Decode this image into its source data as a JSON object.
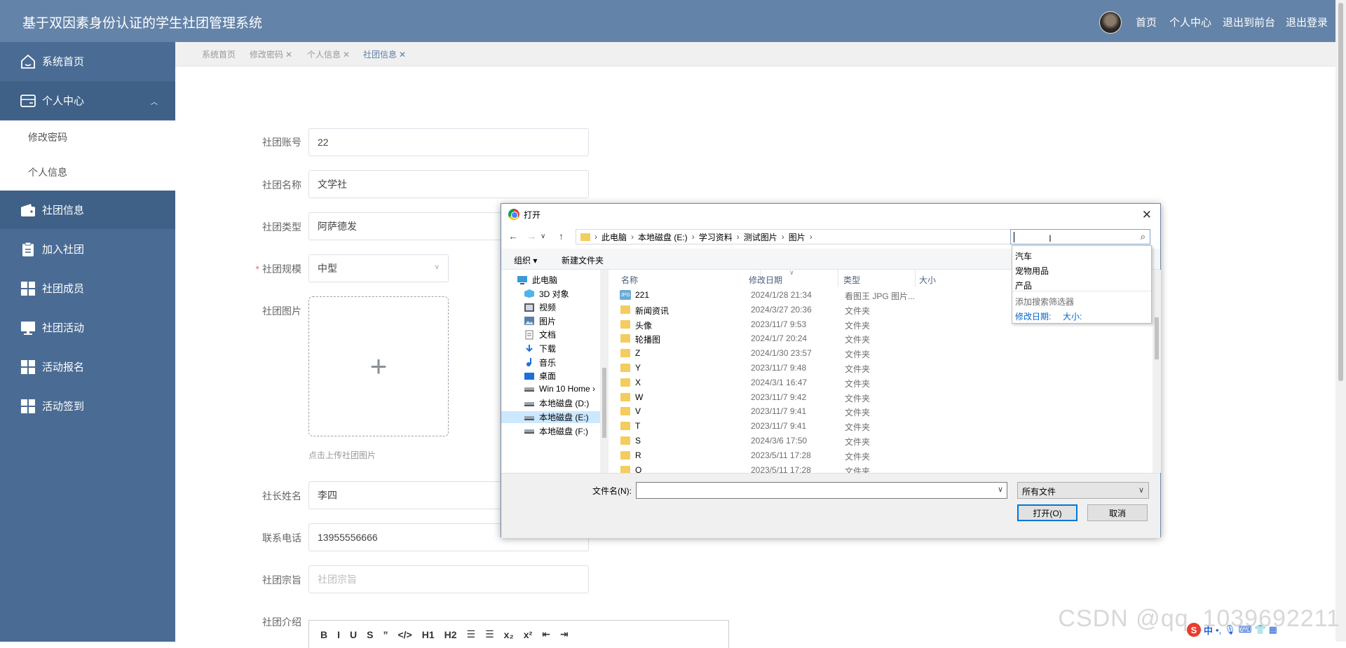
{
  "header": {
    "title": "基于双因素身份认证的学生社团管理系统",
    "links": [
      "首页",
      "个人中心",
      "退出到前台",
      "退出登录"
    ]
  },
  "sidebar": {
    "items": [
      {
        "label": "系统首页",
        "icon": "home-icon"
      },
      {
        "label": "个人中心",
        "icon": "wallet-icon"
      },
      {
        "label": "社团信息",
        "icon": "purse-icon"
      },
      {
        "label": "加入社团",
        "icon": "clipboard-icon"
      },
      {
        "label": "社团成员",
        "icon": "grid-icon"
      },
      {
        "label": "社团活动",
        "icon": "monitor-icon"
      },
      {
        "label": "活动报名",
        "icon": "grid-icon"
      },
      {
        "label": "活动签到",
        "icon": "grid-icon"
      }
    ],
    "sub_items": [
      "修改密码",
      "个人信息"
    ]
  },
  "tabs": [
    "系统首页",
    "修改密码",
    "个人信息",
    "社团信息"
  ],
  "form": {
    "account_label": "社团账号",
    "account_value": "22",
    "name_label": "社团名称",
    "name_value": "文学社",
    "type_label": "社团类型",
    "type_value": "阿萨德发",
    "scale_label": "社团规模",
    "scale_value": "中型",
    "image_label": "社团图片",
    "upload_hint": "点击上传社团图片",
    "leader_label": "社长姓名",
    "leader_value": "李四",
    "phone_label": "联系电话",
    "phone_value": "13955556666",
    "purpose_label": "社团宗旨",
    "purpose_placeholder": "社团宗旨",
    "intro_label": "社团介绍",
    "editor_tools": [
      "B",
      "I",
      "U",
      "S",
      "”",
      "</>",
      "H1",
      "H2",
      "☰",
      "☰",
      "x₂",
      "x²",
      "⇤",
      "⇥"
    ]
  },
  "dialog": {
    "title": "打开",
    "path": [
      "此电脑",
      "本地磁盘 (E:)",
      "学习资料",
      "测试图片",
      "图片"
    ],
    "toolbar": {
      "organize": "组织 ▾",
      "new_folder": "新建文件夹"
    },
    "tree": [
      {
        "label": "此电脑",
        "icon": "computer-icon"
      },
      {
        "label": "3D 对象",
        "icon": "cube-icon"
      },
      {
        "label": "视频",
        "icon": "video-icon"
      },
      {
        "label": "图片",
        "icon": "picture-icon"
      },
      {
        "label": "文档",
        "icon": "document-icon"
      },
      {
        "label": "下载",
        "icon": "download-icon"
      },
      {
        "label": "音乐",
        "icon": "music-icon"
      },
      {
        "label": "桌面",
        "icon": "desktop-icon"
      },
      {
        "label": "Win 10 Home ›",
        "icon": "drive-icon"
      },
      {
        "label": "本地磁盘 (D:)",
        "icon": "drive-icon"
      },
      {
        "label": "本地磁盘 (E:)",
        "icon": "drive-icon"
      },
      {
        "label": "本地磁盘 (F:)",
        "icon": "drive-icon"
      }
    ],
    "columns": [
      "名称",
      "修改日期",
      "类型",
      "大小"
    ],
    "files": [
      {
        "name": "221",
        "date": "2024/1/28 21:34",
        "type": "看图王 JPG 图片...",
        "kind": "jpg",
        "badge": "JPG"
      },
      {
        "name": "新闻资讯",
        "date": "2024/3/27 20:36",
        "type": "文件夹",
        "kind": "folder"
      },
      {
        "name": "头像",
        "date": "2023/11/7 9:53",
        "type": "文件夹",
        "kind": "folder"
      },
      {
        "name": "轮播图",
        "date": "2024/1/7 20:24",
        "type": "文件夹",
        "kind": "folder"
      },
      {
        "name": "Z",
        "date": "2024/1/30 23:57",
        "type": "文件夹",
        "kind": "folder"
      },
      {
        "name": "Y",
        "date": "2023/11/7 9:48",
        "type": "文件夹",
        "kind": "folder"
      },
      {
        "name": "X",
        "date": "2024/3/1 16:47",
        "type": "文件夹",
        "kind": "folder"
      },
      {
        "name": "W",
        "date": "2023/11/7 9:42",
        "type": "文件夹",
        "kind": "folder"
      },
      {
        "name": "V",
        "date": "2023/11/7 9:41",
        "type": "文件夹",
        "kind": "folder"
      },
      {
        "name": "T",
        "date": "2023/11/7 9:41",
        "type": "文件夹",
        "kind": "folder"
      },
      {
        "name": "S",
        "date": "2024/3/6 17:50",
        "type": "文件夹",
        "kind": "folder"
      },
      {
        "name": "R",
        "date": "2023/5/11 17:28",
        "type": "文件夹",
        "kind": "folder"
      },
      {
        "name": "Q",
        "date": "2023/5/11 17:28",
        "type": "文件夹",
        "kind": "folder"
      }
    ],
    "filename_label": "文件名(N):",
    "filename_value": "",
    "filetype": "所有文件",
    "open_label": "打开(O)",
    "cancel_label": "取消",
    "suggestions": [
      "汽车",
      "宠物用品",
      "产品"
    ],
    "add_filter": "添加搜索筛选器",
    "filter_date": "修改日期:",
    "filter_size": "大小:"
  },
  "watermark": "CSDN @qq_1039692211",
  "ime": {
    "s": "S",
    "lang": "中"
  }
}
